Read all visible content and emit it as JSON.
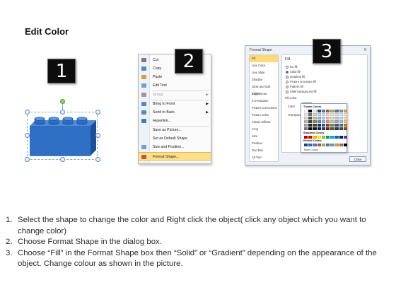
{
  "title": "Edit Color",
  "badges": [
    "1",
    "2",
    "3"
  ],
  "colors": {
    "brick": "#2f6fc4",
    "brick_dark": "#1d4f98",
    "brick_light": "#4d8ad8",
    "highlight": "#ffe08a"
  },
  "context_menu": {
    "items": [
      {
        "icon": "scissors-icon",
        "label": "Cut",
        "enabled": true
      },
      {
        "icon": "copy-icon",
        "label": "Copy",
        "enabled": true
      },
      {
        "icon": "paste-icon",
        "label": "Paste",
        "enabled": true
      },
      {
        "icon": "edit-text-icon",
        "label": "Edit Text",
        "enabled": true
      },
      {
        "icon": "group-icon",
        "label": "Group",
        "enabled": false,
        "submenu": true
      },
      {
        "icon": "bring-front-icon",
        "label": "Bring to Front",
        "enabled": true,
        "submenu": true
      },
      {
        "icon": "send-back-icon",
        "label": "Send to Back",
        "enabled": true,
        "submenu": true
      },
      {
        "icon": "hyperlink-icon",
        "label": "Hyperlink...",
        "enabled": true
      },
      {
        "icon": "",
        "label": "Save as Picture...",
        "enabled": true
      },
      {
        "icon": "",
        "label": "Set as Default Shape",
        "enabled": true
      },
      {
        "icon": "size-position-icon",
        "label": "Size and Position...",
        "enabled": true
      },
      {
        "icon": "format-shape-icon",
        "label": "Format Shape...",
        "enabled": true,
        "highlighted": true
      }
    ]
  },
  "dialog": {
    "title": "Format Shape",
    "categories": [
      "Fill",
      "Line Color",
      "Line Style",
      "Shadow",
      "Glow and Soft Edges",
      "3-D Format",
      "3-D Rotation",
      "Picture Corrections",
      "Picture Color",
      "Artistic Effects",
      "Crop",
      "Size",
      "Position",
      "Text Box",
      "Alt Text"
    ],
    "selected_category": "Fill",
    "fill_heading": "Fill",
    "fill_options": [
      "No fill",
      "Solid fill",
      "Gradient fill",
      "Picture or texture fill",
      "Pattern fill",
      "Slide background fill"
    ],
    "selected_fill": "Solid fill",
    "fill_color_label": "Fill Color",
    "color_label": "Color:",
    "transparency_label": "Transparency:",
    "close_label": "Close",
    "palette": {
      "theme_heading": "Theme Colors",
      "standard_heading": "Standard Colors",
      "recent_heading": "Recent Colors",
      "more_label": "More Colors...",
      "theme_colors": [
        "#ffffff",
        "#000000",
        "#eeece1",
        "#1f497d",
        "#4f81bd",
        "#c0504d",
        "#9bbb59",
        "#8064a2",
        "#4bacc6",
        "#f79646",
        "#f2f2f2",
        "#7f7f7f",
        "#ddd9c3",
        "#c6d9f0",
        "#dbe5f1",
        "#f2dcdb",
        "#ebf1dd",
        "#e5e0ec",
        "#dbeef3",
        "#fdeada",
        "#d8d8d8",
        "#595959",
        "#c4bd97",
        "#8db3e2",
        "#b8cce4",
        "#e5b9b7",
        "#d7e3bc",
        "#ccc1d9",
        "#b7dde8",
        "#fbd5b5",
        "#bfbfbf",
        "#3f3f3f",
        "#938953",
        "#548dd4",
        "#95b3d7",
        "#d99694",
        "#c3d69b",
        "#b2a2c7",
        "#92cddc",
        "#fac08f",
        "#a5a5a5",
        "#262626",
        "#494429",
        "#17365d",
        "#366092",
        "#953734",
        "#76923c",
        "#5f497a",
        "#31859b",
        "#e36c09",
        "#7f7f7f",
        "#0c0c0c",
        "#1d1b10",
        "#0f243e",
        "#244061",
        "#632423",
        "#4f6128",
        "#3f3151",
        "#205867",
        "#974806"
      ],
      "standard_colors": [
        "#c00000",
        "#ff0000",
        "#ffc000",
        "#ffff00",
        "#92d050",
        "#00b050",
        "#00b0f0",
        "#0070c0",
        "#002060",
        "#7030a0"
      ],
      "recent_colors": [
        "#1f497d",
        "#2f6fc4",
        "#4f81bd",
        "#c0504d",
        "#9bbb59",
        "#8064a2",
        "#4bacc6",
        "#f79646",
        "#7f7f7f",
        "#000000"
      ]
    }
  },
  "instructions": [
    {
      "num": "1.",
      "text": "Select the shape to change the color and Right click the object( click any object which you want to change color)"
    },
    {
      "num": "2.",
      "text": "Choose Format Shape in the dialog box."
    },
    {
      "num": "3.",
      "text": "Choose “Fill” in the Format Shape box then “Solid” or “Gradient” depending on the appearance of the object. Change colour as shown in the picture."
    }
  ]
}
